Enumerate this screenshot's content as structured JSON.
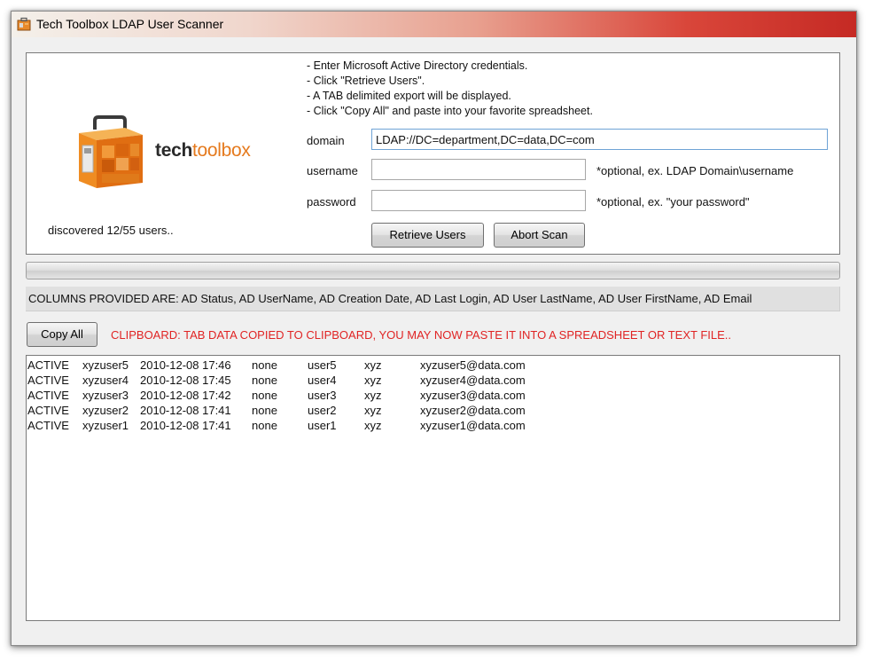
{
  "window": {
    "title": "Tech Toolbox LDAP User Scanner"
  },
  "logo": {
    "tech": "tech",
    "toolbox": "toolbox"
  },
  "status": {
    "discovered": "discovered 12/55 users.."
  },
  "instructions": [
    "- Enter Microsoft Active Directory credentials.",
    "- Click \"Retrieve Users\".",
    "- A TAB delimited export will be displayed.",
    "- Click \"Copy All\" and paste into your favorite spreadsheet."
  ],
  "form": {
    "domain_label": "domain",
    "domain_value": "LDAP://DC=department,DC=data,DC=com",
    "username_label": "username",
    "username_value": "",
    "username_hint": "*optional, ex. LDAP Domain\\username",
    "password_label": "password",
    "password_value": "",
    "password_hint": "*optional, ex. \"your password\""
  },
  "buttons": {
    "retrieve": "Retrieve Users",
    "abort": "Abort Scan",
    "copy_all": "Copy All"
  },
  "progress": {
    "value": 0
  },
  "columns_text": "COLUMNS PROVIDED ARE: AD Status, AD UserName, AD Creation Date, AD Last Login, AD User LastName, AD User FirstName, AD Email",
  "clipboard_message": "CLIPBOARD: TAB DATA COPIED TO CLIPBOARD, YOU MAY NOW PASTE IT INTO A SPREADSHEET OR TEXT FILE..",
  "results": [
    [
      "ACTIVE",
      "xyzuser5",
      "2010-12-08 17:46",
      "none",
      "user5",
      "xyz",
      "xyzuser5@data.com"
    ],
    [
      "ACTIVE",
      "xyzuser4",
      "2010-12-08 17:45",
      "none",
      "user4",
      "xyz",
      "xyzuser4@data.com"
    ],
    [
      "ACTIVE",
      "xyzuser3",
      "2010-12-08 17:42",
      "none",
      "user3",
      "xyz",
      "xyzuser3@data.com"
    ],
    [
      "ACTIVE",
      "xyzuser2",
      "2010-12-08 17:41",
      "none",
      "user2",
      "xyz",
      "xyzuser2@data.com"
    ],
    [
      "ACTIVE",
      "xyzuser1",
      "2010-12-08 17:41",
      "none",
      "user1",
      "xyz",
      "xyzuser1@data.com"
    ]
  ],
  "colors": {
    "accent_orange": "#e57a1e",
    "message_red": "#e02424",
    "progress_green": "#3fb43f"
  },
  "icons": {
    "app": "toolbox-icon",
    "logo": "toolbox-logo-icon"
  }
}
